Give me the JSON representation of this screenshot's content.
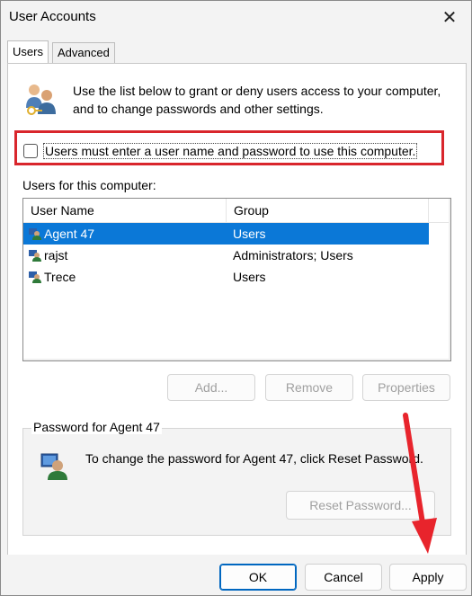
{
  "window": {
    "title": "User Accounts"
  },
  "tabs": [
    {
      "label": "Users",
      "active": true
    },
    {
      "label": "Advanced",
      "active": false
    }
  ],
  "intro_text": "Use the list below to grant or deny users access to your computer, and to change passwords and other settings.",
  "require_login": {
    "label": "Users must enter a user name and password to use this computer.",
    "checked": false
  },
  "users_label": "Users for this computer:",
  "users_table": {
    "columns": [
      "User Name",
      "Group"
    ],
    "rows": [
      {
        "name": "Agent 47",
        "group": "Users",
        "selected": true
      },
      {
        "name": "rajst",
        "group": "Administrators; Users",
        "selected": false
      },
      {
        "name": "Trece",
        "group": "Users",
        "selected": false
      }
    ]
  },
  "list_buttons": {
    "add": "Add...",
    "remove": "Remove",
    "properties": "Properties"
  },
  "password_group": {
    "title": "Password for Agent 47",
    "text": "To change the password for Agent 47, click Reset Password.",
    "reset_button": "Reset Password..."
  },
  "dialog_buttons": {
    "ok": "OK",
    "cancel": "Cancel",
    "apply": "Apply"
  },
  "colors": {
    "selection": "#0b78d7",
    "highlight_box": "#d9262c",
    "arrow": "#e8242c"
  }
}
